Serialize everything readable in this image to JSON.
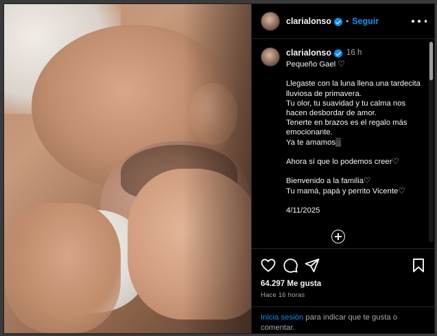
{
  "header": {
    "username": "clarialonso",
    "separator": "•",
    "follow_label": "Seguir"
  },
  "caption": {
    "username": "clarialonso",
    "time": "16 h",
    "text": "Pequeño Gael ♡\n\nLlegaste con la luna llena una tardecita lluviosa de primavera.\nTu olor, tu suavidad y tu calma nos hacen desbordar de amor.\nTenerte en brazos es el regalo más emocionante.\nYa te amamos▒\n\nAhora sí que lo podemos creer♡\n\nBienvenido a la familia♡\nTu mamá, papá y perrito Vicente♡\n\n4/11/2025"
  },
  "actions": {
    "like_icon": "heart-icon",
    "comment_icon": "comment-icon",
    "share_icon": "send-icon",
    "save_icon": "bookmark-icon"
  },
  "stats": {
    "likes": "64.297 Me gusta",
    "ago": "Hace 16 horas"
  },
  "login": {
    "link": "Inicia sesión",
    "rest": " para indicar que te gusta o comentar."
  },
  "colors": {
    "accent": "#0095f6",
    "background": "#000000",
    "text": "#f5f5f5",
    "muted": "#a8a8a8"
  }
}
